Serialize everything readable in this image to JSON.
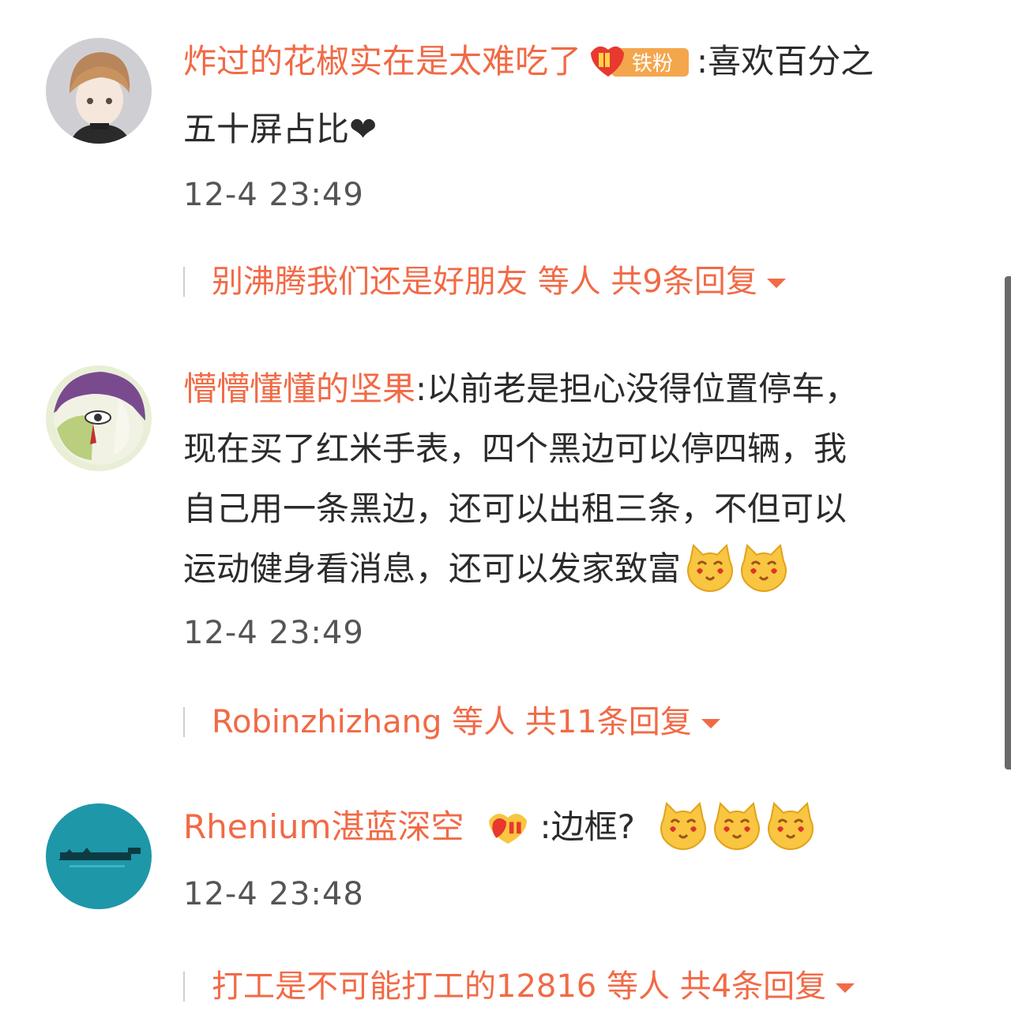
{
  "comments": [
    {
      "username": "炸过的花椒实在是太难吃了",
      "badge_label": "铁粉",
      "text_line1": ":喜欢百分之",
      "text_line2": "五十屏占比❤",
      "time": "12-4 23:49",
      "reply_summary": "别沸腾我们还是好朋友 等人 共9条回复"
    },
    {
      "username": "懵懵懂懂的坚果",
      "text_line1": ":以前老是担心没得位置停车，",
      "text_line2": "现在买了红米手表，四个黑边可以停四辆，我",
      "text_line3": "自己用一条黑边，还可以出租三条，不但可以",
      "text_line4": "运动健身看消息，还可以发家致富",
      "time": "12-4 23:49",
      "reply_summary": "Robinzhizhang 等人 共11条回复"
    },
    {
      "username": "Rhenium湛蓝深空",
      "text_line1": ":边框?",
      "time": "12-4 23:48",
      "reply_summary": "打工是不可能打工的12816 等人 共4条回复"
    }
  ],
  "icons": {
    "fan_badge": "fan-badge-icon",
    "emoji": "greedy-cat-face-emoji",
    "expand": "caret-down-icon"
  },
  "colors": {
    "accent": "#f16a46",
    "text": "#2b2b2b",
    "time": "#555555"
  }
}
